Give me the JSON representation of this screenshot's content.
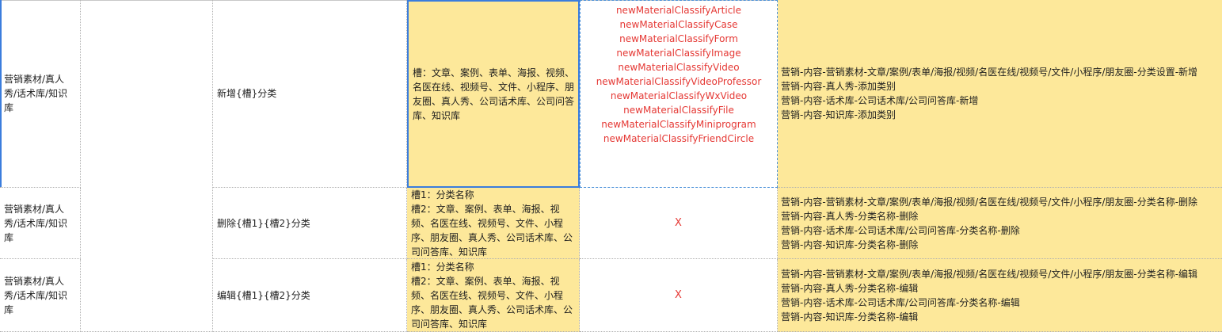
{
  "rows": [
    {
      "module": "营销素材/真人秀/话术库/知识库",
      "action": "新增{槽}分类",
      "slots": [
        "槽：文章、案例、表单、海报、视频、名医在线、视频号、文件、小程序、朋友圈、真人秀、公司话术库、公司问答库、知识库"
      ],
      "codes": [
        "newMaterialClassifyArticle",
        "newMaterialClassifyCase",
        "newMaterialClassifyForm",
        "newMaterialClassifyImage",
        "newMaterialClassifyVideo",
        "newMaterialClassifyVideoProfessor",
        "newMaterialClassifyWxVideo",
        "newMaterialClassifyFile",
        "newMaterialClassifyMiniprogram",
        "newMaterialClassifyFriendCircle"
      ],
      "paths": [
        "营销-内容-营销素材-文章/案例/表单/海报/视频/名医在线/视频号/文件/小程序/朋友圈-分类设置-新增",
        "营销-内容-真人秀-添加类别",
        "营销-内容-话术库-公司话术库/公司问答库-新增",
        "营销-内容-知识库-添加类别"
      ]
    },
    {
      "module": "营销素材/真人秀/话术库/知识库",
      "action": "删除{槽1}{槽2}分类",
      "slots": [
        "槽1：分类名称",
        "槽2：文章、案例、表单、海报、视频、名医在线、视频号、文件、小程序、朋友圈、真人秀、公司话术库、公司问答库、知识库"
      ],
      "code_x": "X",
      "paths": [
        "营销-内容-营销素材-文章/案例/表单/海报/视频/名医在线/视频号/文件/小程序/朋友圈-分类名称-删除",
        "营销-内容-真人秀-分类名称-删除",
        "营销-内容-话术库-公司话术库/公司问答库-分类名称-删除",
        "营销-内容-知识库-分类名称-删除"
      ]
    },
    {
      "module": "营销素材/真人秀/话术库/知识库",
      "action": "编辑{槽1}{槽2}分类",
      "slots": [
        "槽1：分类名称",
        "槽2：文章、案例、表单、海报、视频、名医在线、视频号、文件、小程序、朋友圈、真人秀、公司话术库、公司问答库、知识库"
      ],
      "code_x": "X",
      "paths": [
        "营销-内容-营销素材-文章/案例/表单/海报/视频/名医在线/视频号/文件/小程序/朋友圈-分类名称-编辑",
        "营销-内容-真人秀-分类名称-编辑",
        "营销-内容-话术库-公司话术库/公司问答库-分类名称-编辑",
        "营销-内容-知识库-分类名称-编辑"
      ]
    }
  ],
  "colors": {
    "highlight": "#fde89a",
    "code_text": "#e53935",
    "selection": "#3b7ddd"
  }
}
